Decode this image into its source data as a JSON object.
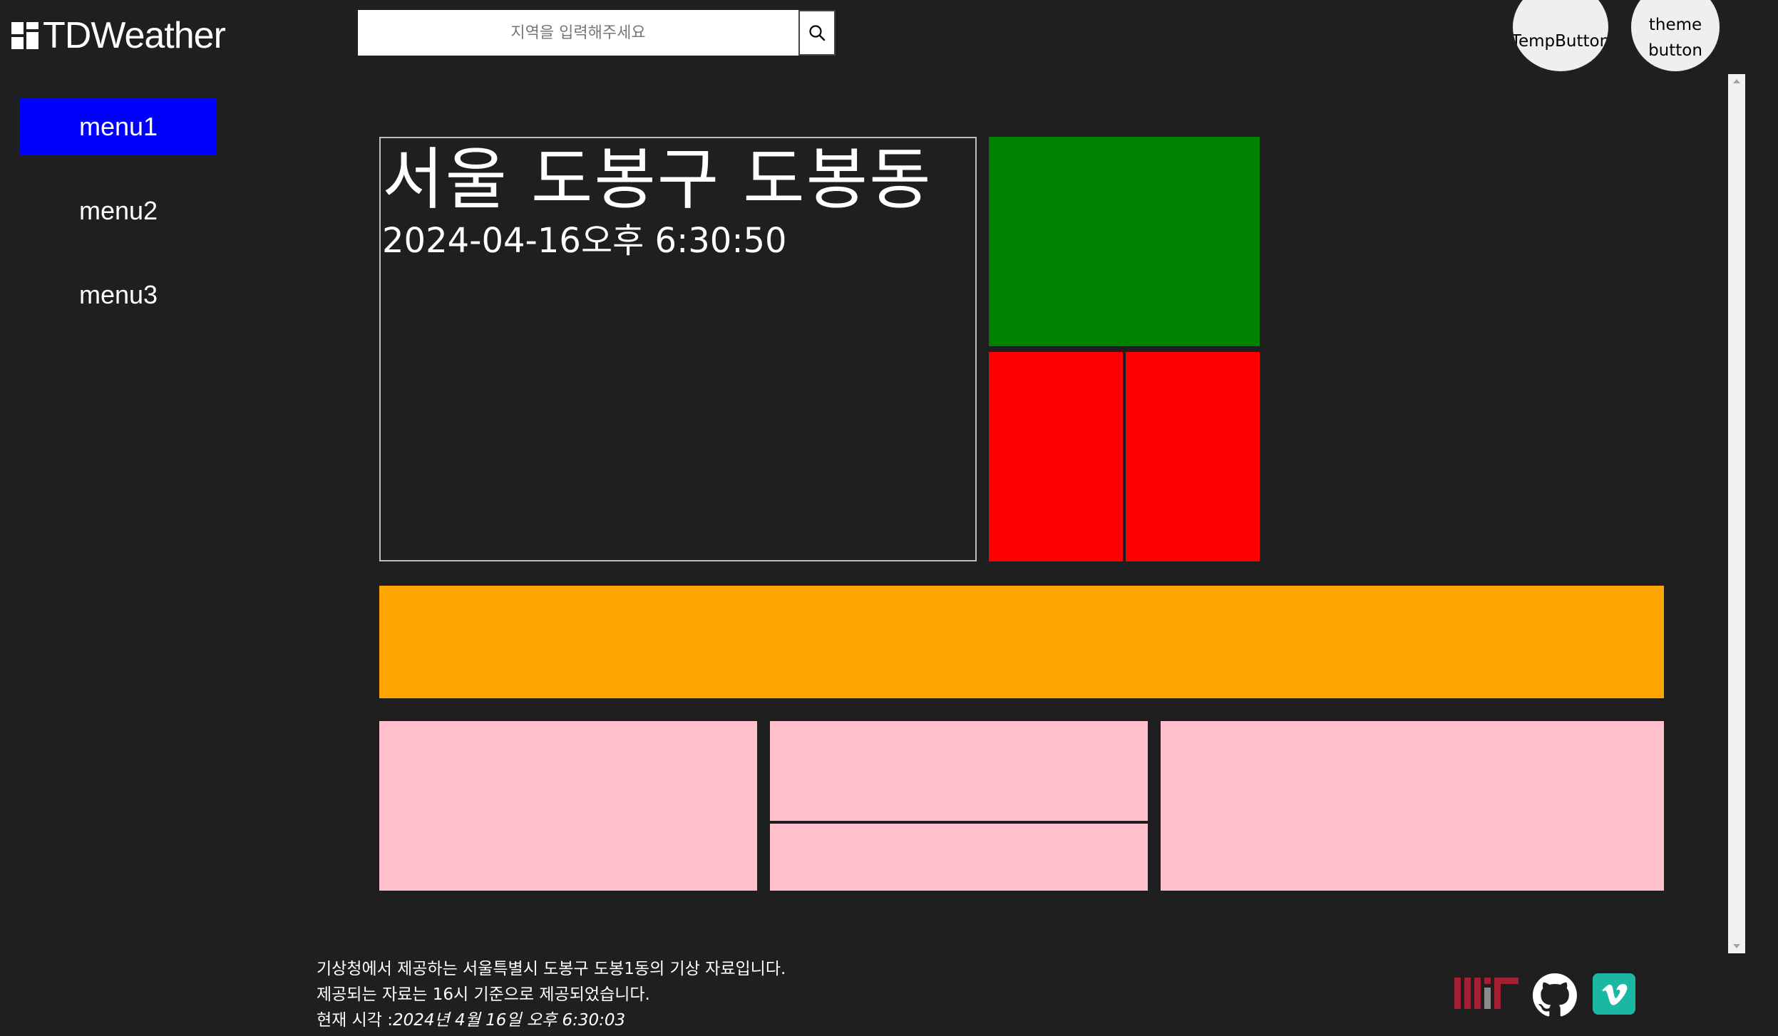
{
  "header": {
    "app_title": "TDWeather",
    "search_placeholder": "지역을 입력해주세요",
    "temp_button_label": "TempButton",
    "theme_button_label_line1": "theme",
    "theme_button_label_line2": "button"
  },
  "sidebar": {
    "items": [
      {
        "label": "menu1",
        "active": true
      },
      {
        "label": "menu2",
        "active": false
      },
      {
        "label": "menu3",
        "active": false
      }
    ]
  },
  "location": {
    "name": "서울 도봉구 도봉동",
    "datetime": "2024-04-16오후 6:30:50"
  },
  "colors": {
    "background": "#1f1f1f",
    "menu_active": "#0000ff",
    "green": "#008000",
    "red": "#ff0000",
    "orange": "#ffa500",
    "pink": "#ffc0cb",
    "vimeo": "#1ab7a4",
    "mit": "#a31f34"
  },
  "footer": {
    "line1": "기상청에서 제공하는 서울특별시 도봉구 도봉1동의 기상 자료입니다.",
    "line2": "제공되는 자료는 16시 기준으로 제공되었습니다.",
    "line3_label": "현재 시각 :",
    "line3_value": "2024년 4월 16일 오후 6:30:03",
    "icons": [
      "mit-icon",
      "github-icon",
      "vimeo-icon"
    ]
  }
}
